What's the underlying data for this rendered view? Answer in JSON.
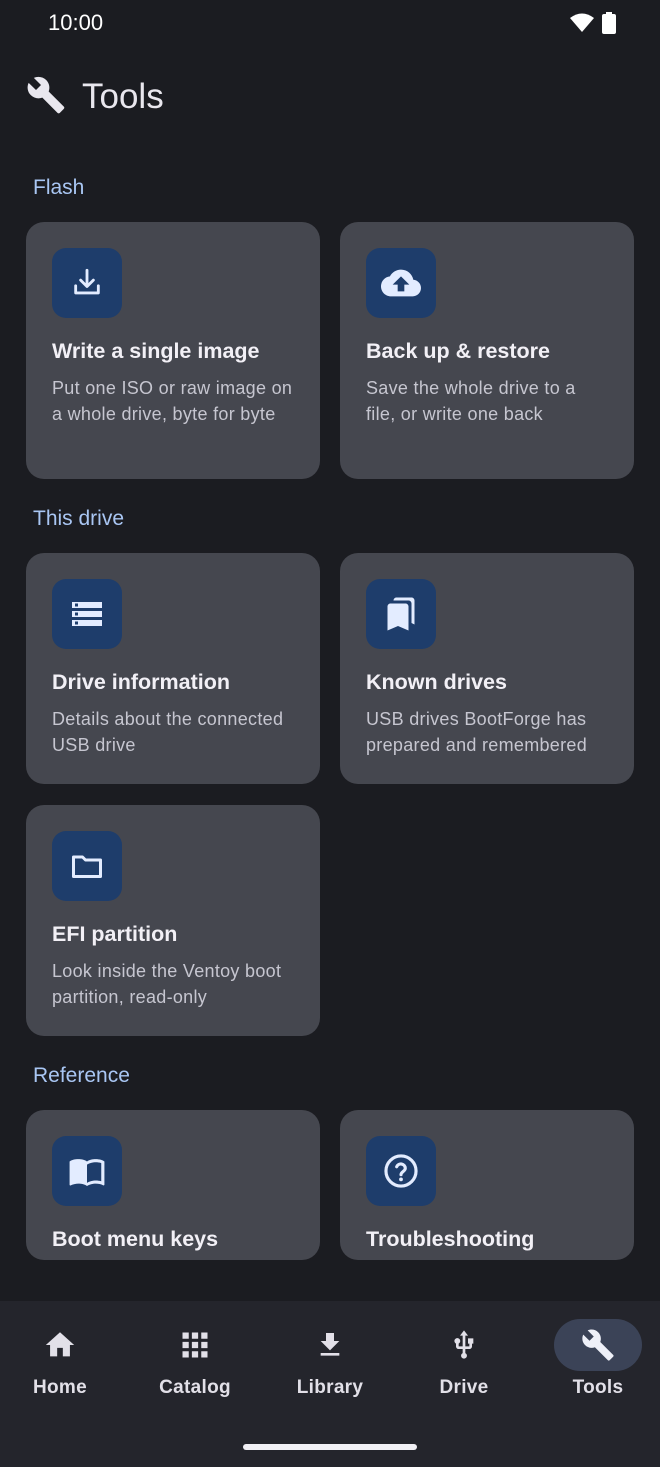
{
  "status": {
    "time": "10:00"
  },
  "app_bar": {
    "title": "Tools",
    "icon": "wrench-icon"
  },
  "sections": {
    "flash": "Flash",
    "this_drive": "This drive",
    "reference": "Reference"
  },
  "cards": {
    "write_image": {
      "title": "Write a single image",
      "desc": "Put one ISO or raw image on a whole drive, byte for byte",
      "icon": "download-icon"
    },
    "backup": {
      "title": "Back up & restore",
      "desc": "Save the whole drive to a file, or write one back",
      "icon": "cloud-upload-icon"
    },
    "drive_info": {
      "title": "Drive information",
      "desc": "Details about the connected USB drive",
      "icon": "storage-icon"
    },
    "known_drives": {
      "title": "Known drives",
      "desc": "USB drives BootForge has prepared and remembered",
      "icon": "bookmarks-icon"
    },
    "efi": {
      "title": "EFI partition",
      "desc": "Look inside the Ventoy boot partition, read-only",
      "icon": "folder-icon"
    },
    "boot_keys": {
      "title": "Boot menu keys",
      "icon": "book-icon"
    },
    "troubleshooting": {
      "title": "Troubleshooting",
      "icon": "help-circle-icon"
    }
  },
  "nav": {
    "home": "Home",
    "catalog": "Catalog",
    "library": "Library",
    "drive": "Drive",
    "tools": "Tools",
    "active": "Tools"
  },
  "colors": {
    "background": "#1b1c21",
    "card": "#45474f",
    "icon_tile": "#1e3d6b",
    "accent_label": "#a9c6f3",
    "nav_active_pill": "#3b4357"
  }
}
